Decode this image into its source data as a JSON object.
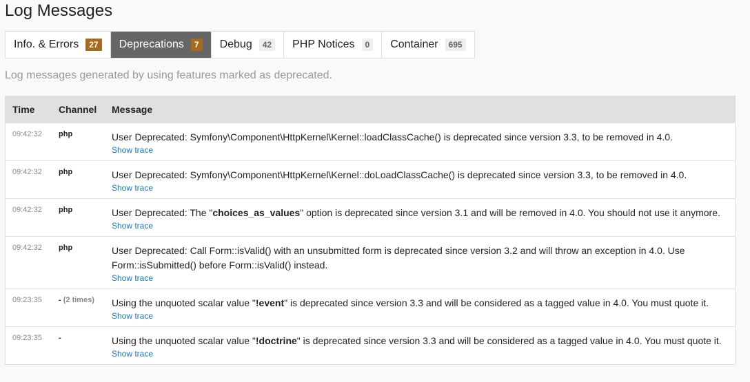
{
  "page": {
    "title": "Log Messages",
    "intro": "Log messages generated by using features marked as deprecated."
  },
  "tabs": [
    {
      "label": "Info. & Errors",
      "count": "27",
      "active": false,
      "badge_style": "warn"
    },
    {
      "label": "Deprecations",
      "count": "7",
      "active": true,
      "badge_style": "warn"
    },
    {
      "label": "Debug",
      "count": "42",
      "active": false,
      "badge_style": "plain"
    },
    {
      "label": "PHP Notices",
      "count": "0",
      "active": false,
      "badge_style": "plain"
    },
    {
      "label": "Container",
      "count": "695",
      "active": false,
      "badge_style": "plain"
    }
  ],
  "table": {
    "headers": {
      "time": "Time",
      "channel": "Channel",
      "message": "Message"
    },
    "trace_label": "Show trace",
    "rows": [
      {
        "time": "09:42:32",
        "channel": "php",
        "channel_count": "",
        "message_parts": [
          "User Deprecated: Symfony\\Component\\HttpKernel\\Kernel::loadClassCache() is deprecated since version 3.3, to be removed in 4.0."
        ]
      },
      {
        "time": "09:42:32",
        "channel": "php",
        "channel_count": "",
        "message_parts": [
          "User Deprecated: Symfony\\Component\\HttpKernel\\Kernel::doLoadClassCache() is deprecated since version 3.3, to be removed in 4.0."
        ]
      },
      {
        "time": "09:42:32",
        "channel": "php",
        "channel_count": "",
        "message_parts": [
          "User Deprecated: The \"",
          "choices_as_values",
          "\" option is deprecated since version 3.1 and will be removed in 4.0. You should not use it anymore."
        ]
      },
      {
        "time": "09:42:32",
        "channel": "php",
        "channel_count": "",
        "message_parts": [
          "User Deprecated: Call Form::isValid() with an unsubmitted form is deprecated since version 3.2 and will throw an exception in 4.0. Use Form::isSubmitted() before Form::isValid() instead."
        ]
      },
      {
        "time": "09:23:35",
        "channel": "-",
        "channel_count": "(2 times)",
        "message_parts": [
          "Using the unquoted scalar value \"",
          "!event",
          "\" is deprecated since version 3.3 and will be considered as a tagged value in 4.0. You must quote it."
        ]
      },
      {
        "time": "09:23:35",
        "channel": "-",
        "channel_count": "",
        "message_parts": [
          "Using the unquoted scalar value \"",
          "!doctrine",
          "\" is deprecated since version 3.3 and will be considered as a tagged value in 4.0. You must quote it."
        ]
      }
    ]
  },
  "colors": {
    "active_tab_bg": "#666666",
    "warn_badge": "#a46a1f",
    "link": "#1a76b6"
  }
}
